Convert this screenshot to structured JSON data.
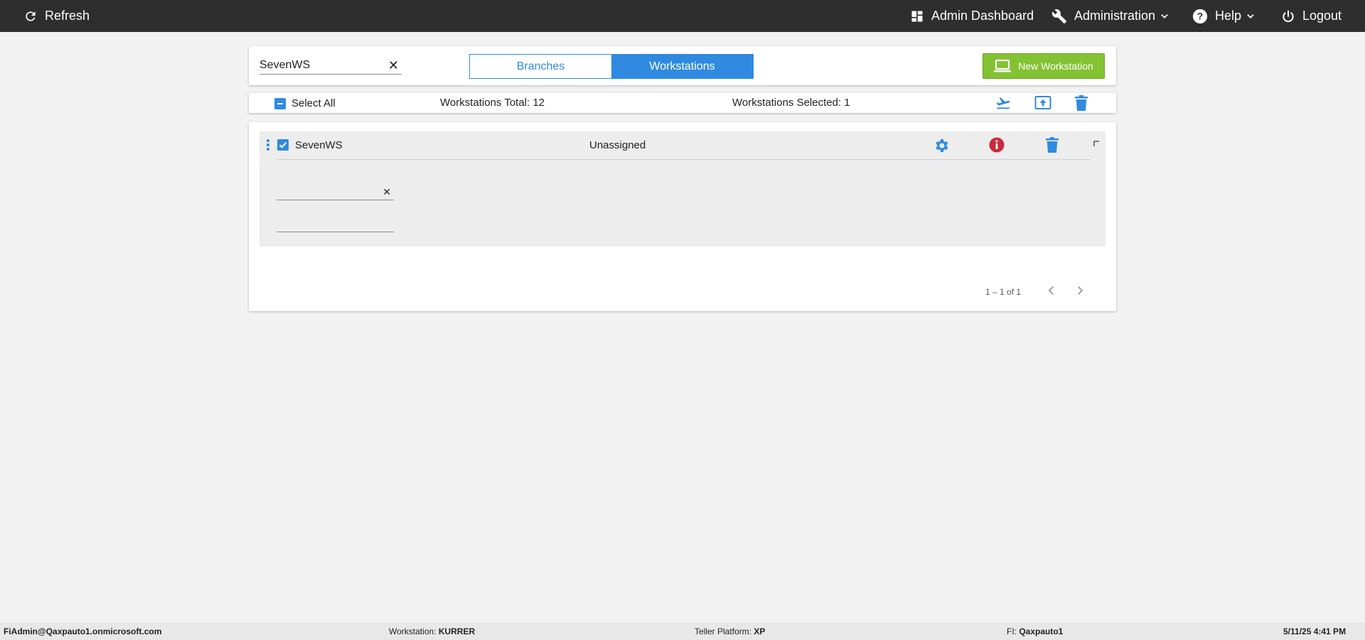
{
  "topbar": {
    "refresh_label": "Refresh",
    "admin_dashboard_label": "Admin Dashboard",
    "administration_label": "Administration",
    "help_label": "Help",
    "logout_label": "Logout"
  },
  "search": {
    "value": "SevenWS",
    "clear_symbol": "✕"
  },
  "tabs": {
    "branches_label": "Branches",
    "workstations_label": "Workstations",
    "active": "Workstations"
  },
  "new_workstation_label": "New Workstation",
  "selection_bar": {
    "select_all_label": "Select All",
    "total_text": "Workstations Total: 12",
    "selected_text": "Workstations Selected: 1"
  },
  "rows": [
    {
      "name": "SevenWS",
      "status": "Unassigned",
      "checked": true,
      "field1_value": "",
      "field1_clear_symbol": "✕",
      "field2_value": ""
    }
  ],
  "pagination": {
    "range_text": "1 – 1 of 1"
  },
  "footer": {
    "user": "FiAdmin@Qaxpauto1.onmicrosoft.com",
    "workstation_label": "Workstation:",
    "workstation_value": "KURRER",
    "platform_label": "Teller Platform:",
    "platform_value": "XP",
    "fi_label": "FI:",
    "fi_value": "Qaxpauto1",
    "datetime": "5/11/25 4:41 PM"
  },
  "colors": {
    "topbar_bg": "#2e2e2e",
    "accent_blue": "#2f8ae0",
    "new_button_green": "#83c232",
    "error_red": "#cc2a3d"
  },
  "icons": {
    "refresh": "refresh-icon",
    "dashboard": "dashboard-icon",
    "wrench": "wrench-icon",
    "help": "help-circle-icon",
    "power": "power-icon",
    "laptop": "laptop-icon",
    "airplane": "airplane-departure-icon",
    "upload": "upload-box-icon",
    "trash": "trash-icon",
    "gear": "gear-icon",
    "info": "info-error-icon",
    "kebab": "kebab-menu-icon"
  }
}
